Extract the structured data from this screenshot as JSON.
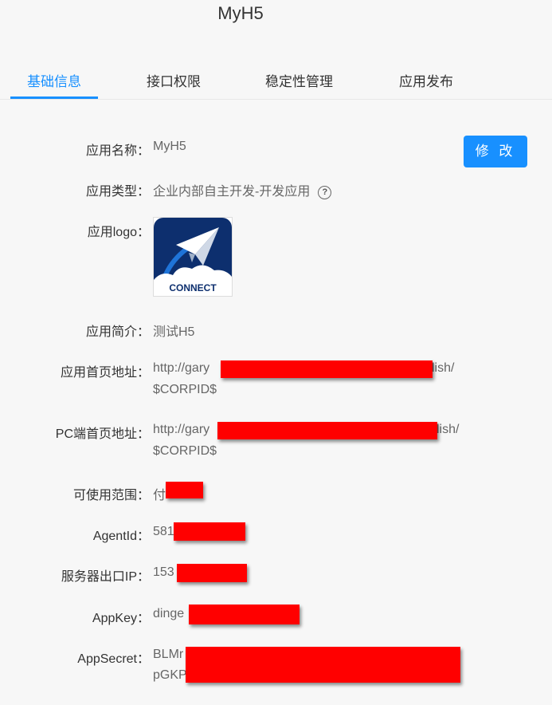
{
  "app_title": "MyH5",
  "tabs": [
    {
      "label": "基础信息",
      "active": true
    },
    {
      "label": "接口权限",
      "active": false
    },
    {
      "label": "稳定性管理",
      "active": false
    },
    {
      "label": "应用发布",
      "active": false
    }
  ],
  "edit_button": "修 改",
  "fields": {
    "name": {
      "label": "应用名称：",
      "value": "MyH5"
    },
    "type": {
      "label": "应用类型：",
      "value": "企业内部自主开发-开发应用"
    },
    "logo": {
      "label": "应用logo：",
      "logo_text": "CONNECT"
    },
    "intro": {
      "label": "应用简介：",
      "value": "测试H5"
    },
    "homepage": {
      "label": "应用首页地址：",
      "value_start": "http://gary",
      "value_end": "lish/",
      "value_line2": "$CORPID$"
    },
    "pc_homepage": {
      "label": "PC端首页地址：",
      "value_start": "http://gary",
      "value_end": "lish/",
      "value_line2": "$CORPID$"
    },
    "scope": {
      "label": "可使用范围：",
      "value": "付"
    },
    "agentid": {
      "label": "AgentId：",
      "value": "581"
    },
    "server_ip": {
      "label": "服务器出口IP：",
      "value": "153"
    },
    "appkey": {
      "label": "AppKey：",
      "value": "dinge"
    },
    "appsecret": {
      "label": "AppSecret：",
      "value_line1": "BLMr",
      "value_line2": "pGKP"
    }
  },
  "colors": {
    "accent": "#1890ff",
    "redaction": "#ff0000"
  }
}
